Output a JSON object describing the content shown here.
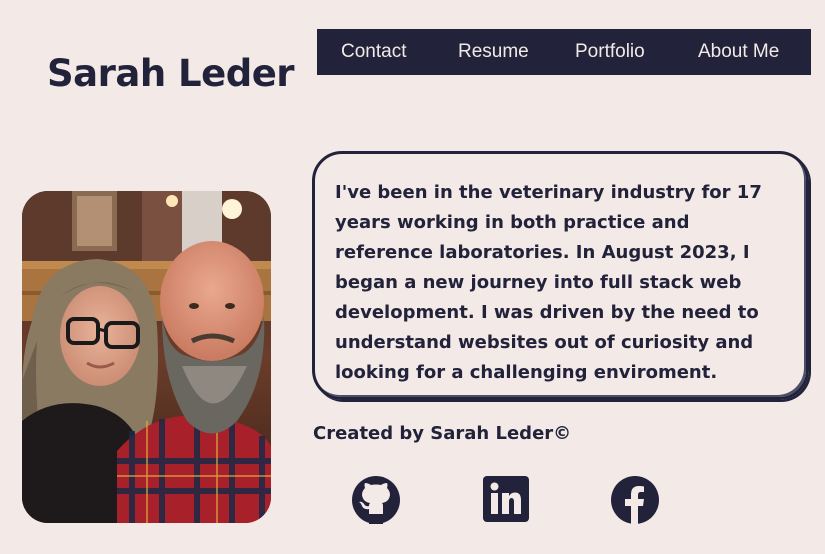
{
  "header": {
    "title": "Sarah Leder"
  },
  "nav": {
    "items": [
      {
        "label": "Contact"
      },
      {
        "label": "Resume"
      },
      {
        "label": "Portfolio"
      },
      {
        "label": "About Me"
      }
    ]
  },
  "about": {
    "bio": "I've been in the veterinary industry for 17 years working in both practice and reference laboratories. In August 2023, I began a new journey into full stack web development. I was driven by the need to understand websites out of curiosity and looking for a challenging enviroment."
  },
  "footer": {
    "credit": "Created by Sarah Leder©",
    "social": [
      {
        "icon": "github-icon"
      },
      {
        "icon": "linkedin-icon"
      },
      {
        "icon": "facebook-icon"
      }
    ]
  },
  "colors": {
    "background": "#f3e9e6",
    "primary": "#22223b",
    "accent": "#4a4e69"
  }
}
